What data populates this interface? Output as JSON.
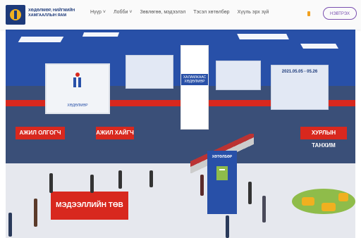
{
  "header": {
    "logo_text": "ХӨДӨЛМӨР, НИЙГМИЙН ХАМГААЛЛЫН ЯАМ",
    "nav": [
      "Нүүр ˅",
      "Лобби ˅",
      "Зөвлөгөө, мэдээлэл",
      "Тэсэл хөтөлбөр",
      "Хүүль эрх зүй"
    ],
    "login": "НЭВТРЭХ"
  },
  "scene": {
    "screen_text": "ХӨДӨЛМӨР",
    "panel_left": "АЖИЛ ОЛГОГЧ",
    "panel_mid": "АЖИЛ ХАЙГЧ",
    "panel_right": "ХУРЛЫН ТАНХИМ",
    "pillar_text": "ХАЛАМЖААС ХӨДӨЛМӨР",
    "banner_right": "2021.05.05 - 05.26",
    "info_desk": "МЭДЭЭЛЛИЙН ТӨВ",
    "kiosk_text": "ХӨТӨЛБӨР"
  }
}
